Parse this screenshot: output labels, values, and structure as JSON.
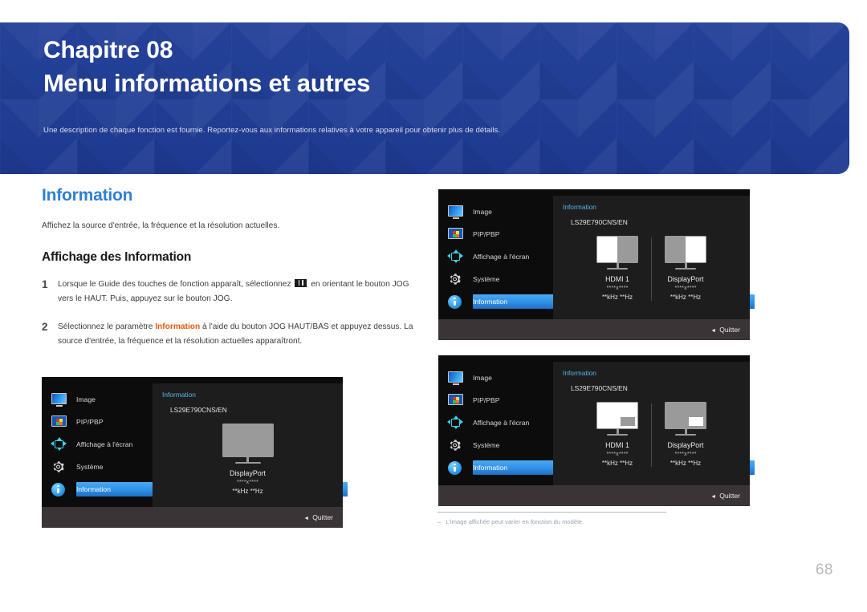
{
  "header": {
    "chapter_label": "Chapitre 08",
    "chapter_title": "Menu informations et autres",
    "subtitle": "Une description de chaque fonction est fournie. Reportez-vous aux informations relatives à votre appareil pour obtenir plus de détails.",
    "background_color": "#1f3d97"
  },
  "content": {
    "section_title": "Information",
    "section_title_color": "#2f7fd6",
    "intro": "Affichez la source d'entrée, la fréquence et la résolution actuelles.",
    "subsection_title": "Affichage des Information",
    "steps": [
      {
        "number": "1",
        "text_before": "Lorsque le Guide des touches de fonction apparaît, sélectionnez ",
        "icon": "menu-bars-icon",
        "text_after": " en orientant le bouton JOG vers le HAUT. Puis, appuyez sur le bouton JOG."
      },
      {
        "number": "2",
        "text_before": "Sélectionnez le paramètre ",
        "keyword": "Information",
        "keyword_color": "#e8590c",
        "text_after": " à l'aide du bouton JOG HAUT/BAS et appuyez dessus. La source d'entrée, la fréquence et la résolution actuelles apparaîtront."
      }
    ]
  },
  "osd_menu_items": [
    {
      "label": "Image",
      "icon": "monitor-icon",
      "selected": false
    },
    {
      "label": "PIP/PBP",
      "icon": "pip-icon",
      "selected": false
    },
    {
      "label": "Affichage à l'écran",
      "icon": "osd-arrows-icon",
      "selected": false
    },
    {
      "label": "Système",
      "icon": "gear-icon",
      "selected": false
    },
    {
      "label": "Information",
      "icon": "info-icon",
      "selected": true
    }
  ],
  "osd_common": {
    "panel_title": "Information",
    "panel_title_color": "#55b8e8",
    "model": "LS29E790CNS/EN",
    "exit_label": "Quitter",
    "exit_caret": "◄",
    "highlight_color": "#2f8fe6"
  },
  "osd_single": {
    "monitors": [
      {
        "mode": "full",
        "screen_fill": "gray",
        "source": "DisplayPort",
        "resolution": "****x****",
        "frequency": "**kHz **Hz"
      }
    ]
  },
  "osd_pbp": {
    "monitors": [
      {
        "mode": "split",
        "left_fill": "white",
        "right_fill": "gray",
        "source": "HDMI 1",
        "resolution": "****x****",
        "frequency": "**kHz **Hz"
      },
      {
        "mode": "split",
        "left_fill": "gray",
        "right_fill": "white",
        "source": "DisplayPort",
        "resolution": "****x****",
        "frequency": "**kHz **Hz"
      }
    ]
  },
  "osd_pip": {
    "monitors": [
      {
        "mode": "pip",
        "screen_fill": "white",
        "pip_fill": "gray",
        "source": "HDMI 1",
        "resolution": "****x****",
        "frequency": "**kHz **Hz"
      },
      {
        "mode": "pip",
        "screen_fill": "gray",
        "pip_fill": "white",
        "source": "DisplayPort",
        "resolution": "****x****",
        "frequency": "**kHz **Hz"
      }
    ]
  },
  "footnote": {
    "dash": "‒",
    "text": "L'image affichée peut varier en fonction du modèle."
  },
  "page_number": "68"
}
